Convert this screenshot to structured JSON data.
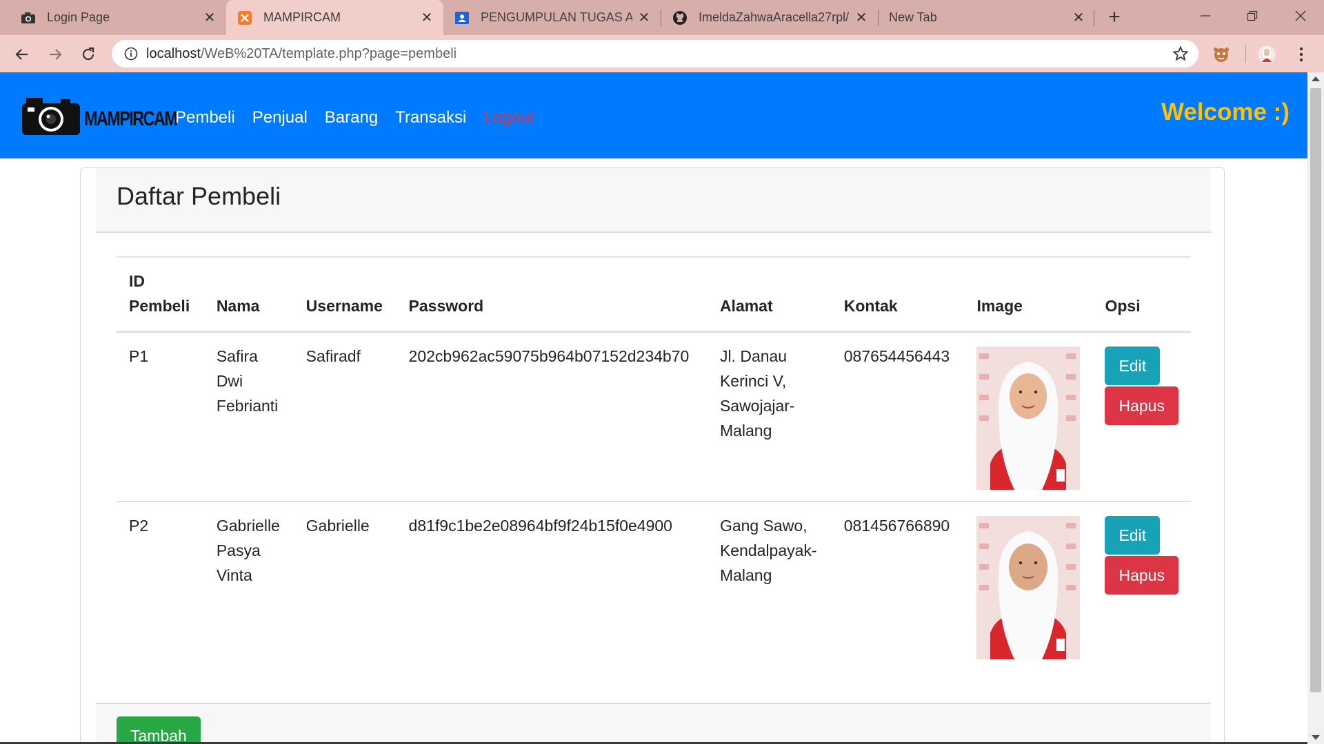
{
  "browser": {
    "tabs": [
      {
        "title": "Login Page",
        "icon": "camera-favicon-icon",
        "active": false
      },
      {
        "title": "MAMPIRCAM",
        "icon": "xampp-favicon-icon",
        "active": true
      },
      {
        "title": "PENGUMPULAN TUGAS AK",
        "icon": "classroom-favicon-icon",
        "active": false
      },
      {
        "title": "ImeldaZahwaAracella27rpl/",
        "icon": "github-favicon-icon",
        "active": false
      },
      {
        "title": "New Tab",
        "icon": "",
        "active": false
      }
    ],
    "url_host": "localhost",
    "url_path": "/WeB%20TA/template.php?page=pembeli"
  },
  "navbar": {
    "brand": "MAMPIRCAM",
    "links": [
      "Pembeli",
      "Penjual",
      "Barang",
      "Transaksi",
      "Logout"
    ],
    "welcome": "Welcome :)",
    "colors": {
      "bg": "#007bff",
      "welcome": "#ffc107",
      "logout": "#dc3545"
    }
  },
  "card": {
    "title": "Daftar Pembeli",
    "columns": [
      "ID Pembeli",
      "Nama",
      "Username",
      "Password",
      "Alamat",
      "Kontak",
      "Image",
      "Opsi"
    ],
    "rows": [
      {
        "id": "P1",
        "nama": "Safira Dwi Febrianti",
        "username": "Safiradf",
        "password": "202cb962ac59075b964b07152d234b70",
        "alamat": "Jl. Danau Kerinci V, Sawojajar-Malang",
        "kontak": "087654456443",
        "edit": "Edit",
        "hapus": "Hapus"
      },
      {
        "id": "P2",
        "nama": "Gabrielle Pasya Vinta",
        "username": "Gabrielle",
        "password": "d81f9c1be2e08964bf9f24b15f0e4900",
        "alamat": "Gang Sawo, Kendalpayak-Malang",
        "kontak": "081456766890",
        "edit": "Edit",
        "hapus": "Hapus"
      }
    ],
    "add_button": "Tambah",
    "button_colors": {
      "edit": "#17a2b8",
      "hapus": "#dc3545",
      "tambah": "#28a745"
    }
  }
}
